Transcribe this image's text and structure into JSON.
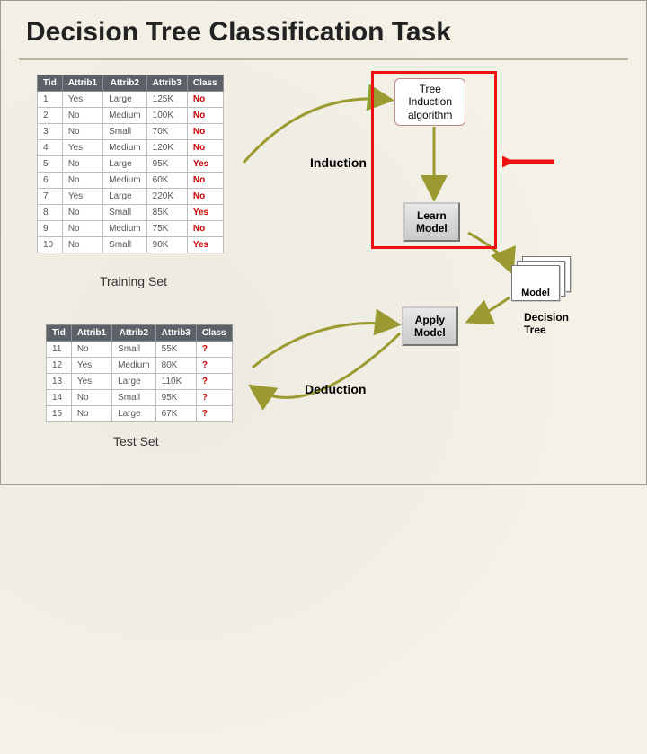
{
  "title": "Decision Tree Classification Task",
  "training": {
    "caption": "Training Set",
    "headers": [
      "Tid",
      "Attrib1",
      "Attrib2",
      "Attrib3",
      "Class"
    ],
    "rows": [
      [
        "1",
        "Yes",
        "Large",
        "125K",
        "No"
      ],
      [
        "2",
        "No",
        "Medium",
        "100K",
        "No"
      ],
      [
        "3",
        "No",
        "Small",
        "70K",
        "No"
      ],
      [
        "4",
        "Yes",
        "Medium",
        "120K",
        "No"
      ],
      [
        "5",
        "No",
        "Large",
        "95K",
        "Yes"
      ],
      [
        "6",
        "No",
        "Medium",
        "60K",
        "No"
      ],
      [
        "7",
        "Yes",
        "Large",
        "220K",
        "No"
      ],
      [
        "8",
        "No",
        "Small",
        "85K",
        "Yes"
      ],
      [
        "9",
        "No",
        "Medium",
        "75K",
        "No"
      ],
      [
        "10",
        "No",
        "Small",
        "90K",
        "Yes"
      ]
    ]
  },
  "test": {
    "caption": "Test Set",
    "headers": [
      "Tid",
      "Attrib1",
      "Attrib2",
      "Attrib3",
      "Class"
    ],
    "rows": [
      [
        "11",
        "No",
        "Small",
        "55K",
        "?"
      ],
      [
        "12",
        "Yes",
        "Medium",
        "80K",
        "?"
      ],
      [
        "13",
        "Yes",
        "Large",
        "110K",
        "?"
      ],
      [
        "14",
        "No",
        "Small",
        "95K",
        "?"
      ],
      [
        "15",
        "No",
        "Large",
        "67K",
        "?"
      ]
    ]
  },
  "nodes": {
    "algo": "Tree\nInduction\nalgorithm",
    "induction": "Induction",
    "learn": "Learn\nModel",
    "apply": "Apply\nModel",
    "model": "Model",
    "deduction": "Deduction",
    "decision_tree": "Decision\nTree"
  }
}
